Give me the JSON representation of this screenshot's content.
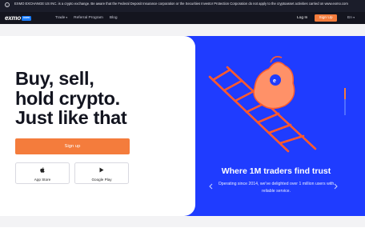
{
  "disclaimer": {
    "text": "EXMO EXCHANGE US INC. is a crypto exchange. Be aware that the Federal Deposit Insurance corporation or the Securities Investor Protection Corporation do not apply to the cryptoasset activities carried on www.exmo.com"
  },
  "nav": {
    "logo_text": "exmo",
    "logo_badge": "com",
    "links": [
      {
        "label": "Trade",
        "has_caret": true
      },
      {
        "label": "Referral Program"
      },
      {
        "label": "Blog"
      }
    ],
    "login_label": "Log In",
    "signup_label": "Sign Up",
    "language": "En"
  },
  "hero": {
    "headline": [
      "Buy, sell,",
      "hold crypto.",
      "Just like that"
    ],
    "signup_label": "Sign up",
    "app_store_label": "App Store",
    "google_play_label": "Google Play"
  },
  "promo": {
    "tagline": "Where 1M traders find trust",
    "subtext": "Operating since 2014, we've delighted over 1 million users with reliable service.",
    "slide_progress": 0.4
  },
  "colors": {
    "accent_orange": "#f47c3c",
    "promo_blue": "#1f3cff",
    "nav_dark": "#14151f"
  },
  "icons": {
    "caret": "▾",
    "lang_caret": "▾",
    "apple": "",
    "play": "▶",
    "arrow_left": "‹",
    "arrow_right": "›",
    "info": "i"
  }
}
